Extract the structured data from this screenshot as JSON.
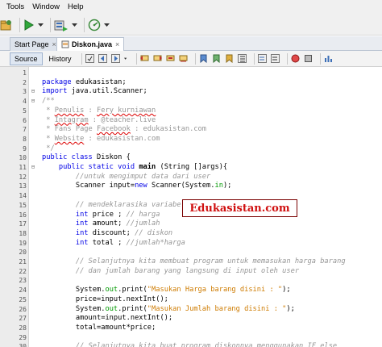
{
  "menubar": {
    "items": [
      "Tools",
      "Window",
      "Help"
    ]
  },
  "toolbar": {
    "icons": [
      "open-project-icon",
      "run-icon",
      "build-icon",
      "profile-icon"
    ]
  },
  "tabs": [
    {
      "label": "Start Page",
      "close": "×"
    },
    {
      "label": "Diskon.java",
      "close": "×"
    }
  ],
  "editor_toolbar": {
    "source_label": "Source",
    "history_label": "History"
  },
  "code_lines": [
    {
      "n": "1",
      "fold": "",
      "html": ""
    },
    {
      "n": "2",
      "fold": "",
      "html": "<span class=\"kw\">package</span> edukasistan;"
    },
    {
      "n": "3",
      "fold": "⊟",
      "html": "<span class=\"kw\">import</span> java.util.Scanner;"
    },
    {
      "n": "4",
      "fold": "⊟",
      "html": "<span class=\"cm\">/**</span>"
    },
    {
      "n": "5",
      "fold": "",
      "html": "<span class=\"cm\"> * <span class=\"ul\">Penulis</span> : <span class=\"ul\">Fery kurniawan</span></span>"
    },
    {
      "n": "6",
      "fold": "",
      "html": "<span class=\"cm\"> * <span class=\"ul\">Intagram</span> : @teacher.live</span>"
    },
    {
      "n": "7",
      "fold": "",
      "html": "<span class=\"cm\"> * Fans Page <span class=\"ul\">Facebook</span> : edukasistan.com</span>"
    },
    {
      "n": "8",
      "fold": "",
      "html": "<span class=\"cm\"> * <span class=\"ul\">Website</span> : edukasistan.com</span>"
    },
    {
      "n": "9",
      "fold": "",
      "html": "<span class=\"cm\"> */</span>"
    },
    {
      "n": "10",
      "fold": "",
      "html": "<span class=\"kw\">public class</span> Diskon {"
    },
    {
      "n": "11",
      "fold": "⊟",
      "html": "    <span class=\"kw\">public static void</span> <span class=\"bold\">main</span> (String []args){"
    },
    {
      "n": "12",
      "fold": "",
      "html": "        <span class=\"cmi\">//untuk mengimput data dari user</span>"
    },
    {
      "n": "13",
      "fold": "",
      "html": "        Scanner input=<span class=\"kw\">new</span> Scanner(System.<span class=\"fld\">in</span>);"
    },
    {
      "n": "14",
      "fold": "",
      "html": ""
    },
    {
      "n": "15",
      "fold": "",
      "html": "        <span class=\"cmi\">// mendeklarasika variabel</span>"
    },
    {
      "n": "16",
      "fold": "",
      "html": "        <span class=\"kw\">int</span> price ; <span class=\"cmi\">// harga</span>"
    },
    {
      "n": "17",
      "fold": "",
      "html": "        <span class=\"kw\">int</span> amount; <span class=\"cmi\">//jumlah</span>"
    },
    {
      "n": "18",
      "fold": "",
      "html": "        <span class=\"kw\">int</span> discount; <span class=\"cmi\">// diskon</span>"
    },
    {
      "n": "19",
      "fold": "",
      "html": "        <span class=\"kw\">int</span> total ; <span class=\"cmi\">//jumlah*harga</span>"
    },
    {
      "n": "20",
      "fold": "",
      "html": ""
    },
    {
      "n": "21",
      "fold": "",
      "html": "        <span class=\"cmi\">// Selanjutnya kita membuat program untuk memasukan harga barang</span>"
    },
    {
      "n": "22",
      "fold": "",
      "html": "        <span class=\"cmi\">// dan jumlah barang yang langsung di input oleh user</span>"
    },
    {
      "n": "23",
      "fold": "",
      "html": ""
    },
    {
      "n": "24",
      "fold": "",
      "html": "        System.<span class=\"fld\">out</span>.print(<span class=\"str\">\"Masukan Harga barang disini : \"</span>);"
    },
    {
      "n": "25",
      "fold": "",
      "html": "        price=input.nextInt();"
    },
    {
      "n": "26",
      "fold": "",
      "html": "        System.<span class=\"fld\">out</span>.print(<span class=\"str\">\"Masukan Jumlah barang disini : \"</span>);"
    },
    {
      "n": "27",
      "fold": "",
      "html": "        amount=input.nextInt();"
    },
    {
      "n": "28",
      "fold": "",
      "html": "        total=amount*price;"
    },
    {
      "n": "29",
      "fold": "",
      "html": ""
    },
    {
      "n": "30",
      "fold": "",
      "html": "        <span class=\"cmi\">// Selanjutnya kita buat program diskonnya menggunakan IF else</span>"
    }
  ],
  "watermark": "Edukasistan.com"
}
